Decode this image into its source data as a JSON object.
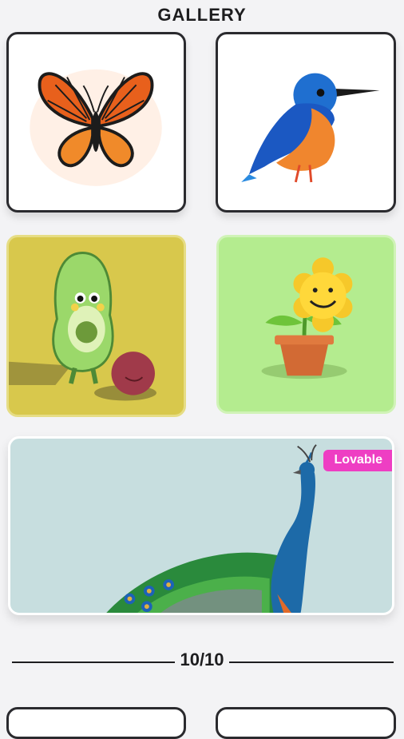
{
  "header": {
    "title": "GALLERY"
  },
  "gallery": {
    "items": [
      {
        "name": "Butterfly",
        "icon": "butterfly-icon"
      },
      {
        "name": "Kingfisher",
        "icon": "kingfisher-icon"
      },
      {
        "name": "Avocado",
        "icon": "avocado-icon"
      },
      {
        "name": "Sunflower",
        "icon": "sunflower-icon"
      },
      {
        "name": "Peacock",
        "icon": "peacock-icon",
        "badge": "Lovable"
      }
    ]
  },
  "pagination": {
    "counter": "10/10"
  }
}
